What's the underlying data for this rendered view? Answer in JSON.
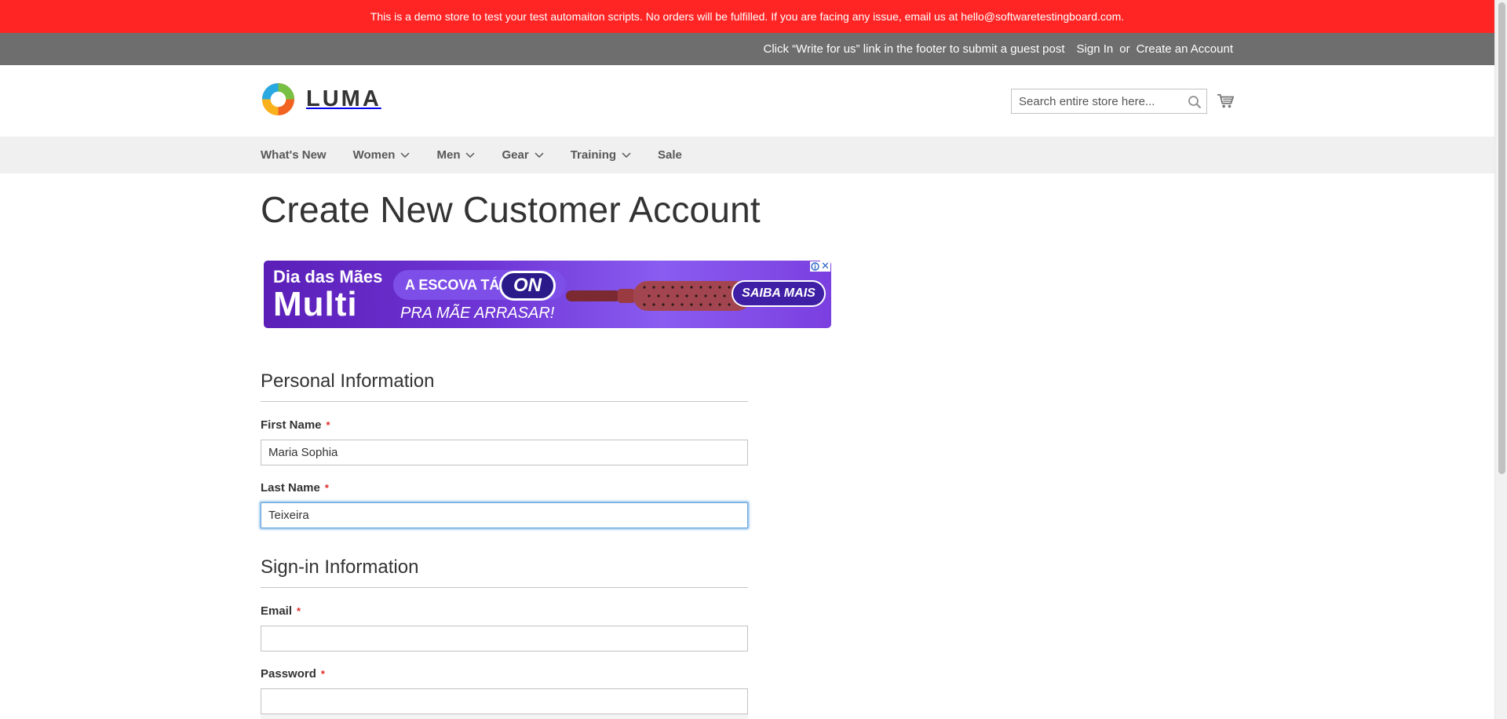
{
  "demo_notice": "This is a demo store to test your test automaiton scripts. No orders will be fulfilled. If you are facing any issue, email us at hello@softwaretestingboard.com.",
  "topbar": {
    "promo": "Click “Write for us” link in the footer to submit a guest post",
    "sign_in": "Sign In",
    "or": "or",
    "create_account": "Create an Account"
  },
  "header": {
    "logo_text": "LUMA",
    "search_placeholder": "Search entire store here...",
    "search_icon": "search-icon",
    "cart_icon": "cart-icon"
  },
  "nav": {
    "items": [
      {
        "label": "What's New",
        "has_dropdown": false
      },
      {
        "label": "Women",
        "has_dropdown": true
      },
      {
        "label": "Men",
        "has_dropdown": true
      },
      {
        "label": "Gear",
        "has_dropdown": true
      },
      {
        "label": "Training",
        "has_dropdown": true
      },
      {
        "label": "Sale",
        "has_dropdown": false
      }
    ]
  },
  "page_title": "Create New Customer Account",
  "ad": {
    "line1": "Dia das Mães",
    "line2": "Multi",
    "pill_text": "A ESCOVA TÁ",
    "badge": "ON",
    "subline": "PRA MÃE ARRASAR!",
    "cta": "SAIBA MAIS",
    "close": "✕"
  },
  "personal_info": {
    "title": "Personal Information",
    "first_name": {
      "label": "First Name",
      "required_mark": "*",
      "value": "Maria Sophia"
    },
    "last_name": {
      "label": "Last Name",
      "required_mark": "*",
      "value": "Teixeira"
    }
  },
  "signin_info": {
    "title": "Sign-in Information",
    "email": {
      "label": "Email",
      "required_mark": "*",
      "value": ""
    },
    "password": {
      "label": "Password",
      "required_mark": "*",
      "value": ""
    }
  },
  "colors": {
    "demo_banner": "#ff2525",
    "topbar": "#6e6e6e",
    "nav_bg": "#f0f0f0",
    "required": "#e02b27",
    "focus": "#68a8e0"
  }
}
